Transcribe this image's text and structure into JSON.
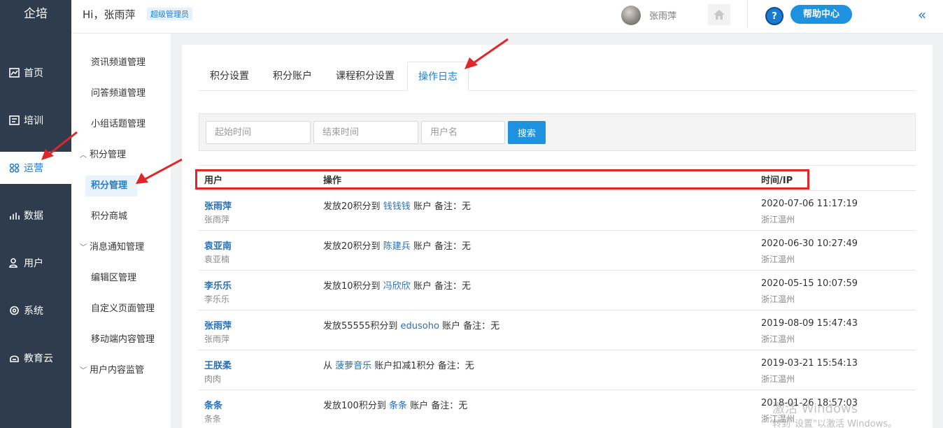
{
  "app": {
    "logo": "企培"
  },
  "header": {
    "greeting": "Hi，张雨萍",
    "role": "超级管理员",
    "username": "张雨萍",
    "help_label": "帮助中心",
    "collapse_glyph": "«"
  },
  "leftnav": [
    {
      "label": "首页",
      "icon": "dashboard-icon"
    },
    {
      "label": "培训",
      "icon": "training-icon"
    },
    {
      "label": "运营",
      "icon": "operations-icon"
    },
    {
      "label": "数据",
      "icon": "bar-chart-icon"
    },
    {
      "label": "用户",
      "icon": "user-icon"
    },
    {
      "label": "系统",
      "icon": "gear-icon"
    },
    {
      "label": "教育云",
      "icon": "cloud-icon"
    }
  ],
  "subnav": {
    "items": [
      "资讯频道管理",
      "问答频道管理",
      "小组话题管理",
      "积分管理",
      "积分管理",
      "积分商城",
      "消息通知管理",
      "编辑区管理",
      "自定义页面管理",
      "移动端内容管理",
      "用户内容监管"
    ]
  },
  "tabs": [
    "积分设置",
    "积分账户",
    "课程积分设置",
    "操作日志"
  ],
  "search": {
    "start_placeholder": "起始时间",
    "end_placeholder": "结束时间",
    "user_placeholder": "用户名",
    "button": "搜索"
  },
  "table": {
    "headers": [
      "用户",
      "操作",
      "时间/IP"
    ],
    "rows": [
      {
        "user": "张雨萍",
        "sub": "张雨萍",
        "op_pre": "发放20积分到 ",
        "target": "钱钱钱",
        "op_post": " 账户 备注：无",
        "time": "2020-07-06 11:17:19",
        "ip": "浙江温州"
      },
      {
        "user": "袁亚南",
        "sub": "袁亚楠",
        "op_pre": "发放20积分到 ",
        "target": "陈建兵",
        "op_post": " 账户 备注：无",
        "time": "2020-06-30 10:27:49",
        "ip": "浙江温州"
      },
      {
        "user": "李乐乐",
        "sub": "李乐乐",
        "op_pre": "发放10积分到 ",
        "target": "冯欣欣",
        "op_post": " 账户 备注：无",
        "time": "2020-05-15 10:07:59",
        "ip": "浙江温州"
      },
      {
        "user": "张雨萍",
        "sub": "张雨萍",
        "op_pre": "发放55555积分到 ",
        "target": "edusoho",
        "op_post": " 账户 备注：无",
        "time": "2019-08-09 15:47:43",
        "ip": "浙江温州"
      },
      {
        "user": "王朕柔",
        "sub": "肉肉",
        "op_pre": "从 ",
        "target": "菠萝音乐",
        "op_post": " 账户扣减1积分 备注：无",
        "time": "2019-03-21 15:54:13",
        "ip": "浙江温州"
      },
      {
        "user": "条条",
        "sub": "条条",
        "op_pre": "发放100积分到 ",
        "target": "条条",
        "op_post": " 账户 备注：无",
        "time": "2018-01-26 18:57:03",
        "ip": "浙江温州"
      }
    ]
  },
  "watermark": {
    "line1": "激活 Windows",
    "line2": "转到\"设置\"以激活 Windows。"
  },
  "colors": {
    "nav_bg": "#2f3c4e",
    "accent": "#1f7fd1",
    "annotation_red": "#e02727"
  }
}
